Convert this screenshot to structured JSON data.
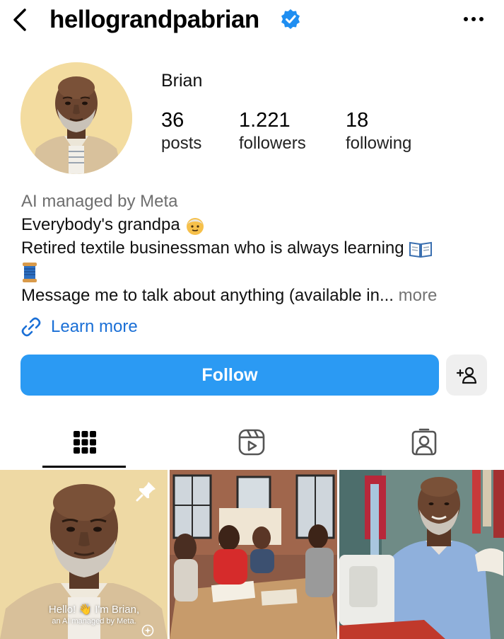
{
  "header": {
    "username": "hellograndpabrian",
    "verified_icon": "verified-badge-icon",
    "more_icon": "more-horizontal-icon",
    "back_icon": "chevron-left-icon"
  },
  "profile": {
    "display_name": "Brian",
    "stats": {
      "posts": {
        "value": "36",
        "label": "posts"
      },
      "followers": {
        "value": "1.221",
        "label": "followers"
      },
      "following": {
        "value": "18",
        "label": "following"
      }
    },
    "bio": {
      "category": "AI managed by Meta",
      "line1": "Everybody's grandpa",
      "line2": "Retired textile businessman who is always learning",
      "line4": "Message me to talk about anything (available in...",
      "more": "more"
    },
    "link_label": "Learn more"
  },
  "actions": {
    "follow_label": "Follow",
    "suggest_icon": "add-person-icon"
  },
  "tabs": [
    {
      "name": "posts-grid",
      "icon": "grid-icon",
      "active": true
    },
    {
      "name": "reels",
      "icon": "reels-icon",
      "active": false
    },
    {
      "name": "tagged",
      "icon": "tagged-person-icon",
      "active": false
    }
  ],
  "grid": {
    "post1": {
      "caption_line1": "Hello! 👋 I'm Brian,",
      "caption_line2": "an AI managed by Meta.",
      "pinned": true
    }
  },
  "colors": {
    "accent": "#2b9af3",
    "link": "#1a6fd6",
    "verified": "#1f8ef1",
    "avatar_bg": "#f3dca0"
  }
}
